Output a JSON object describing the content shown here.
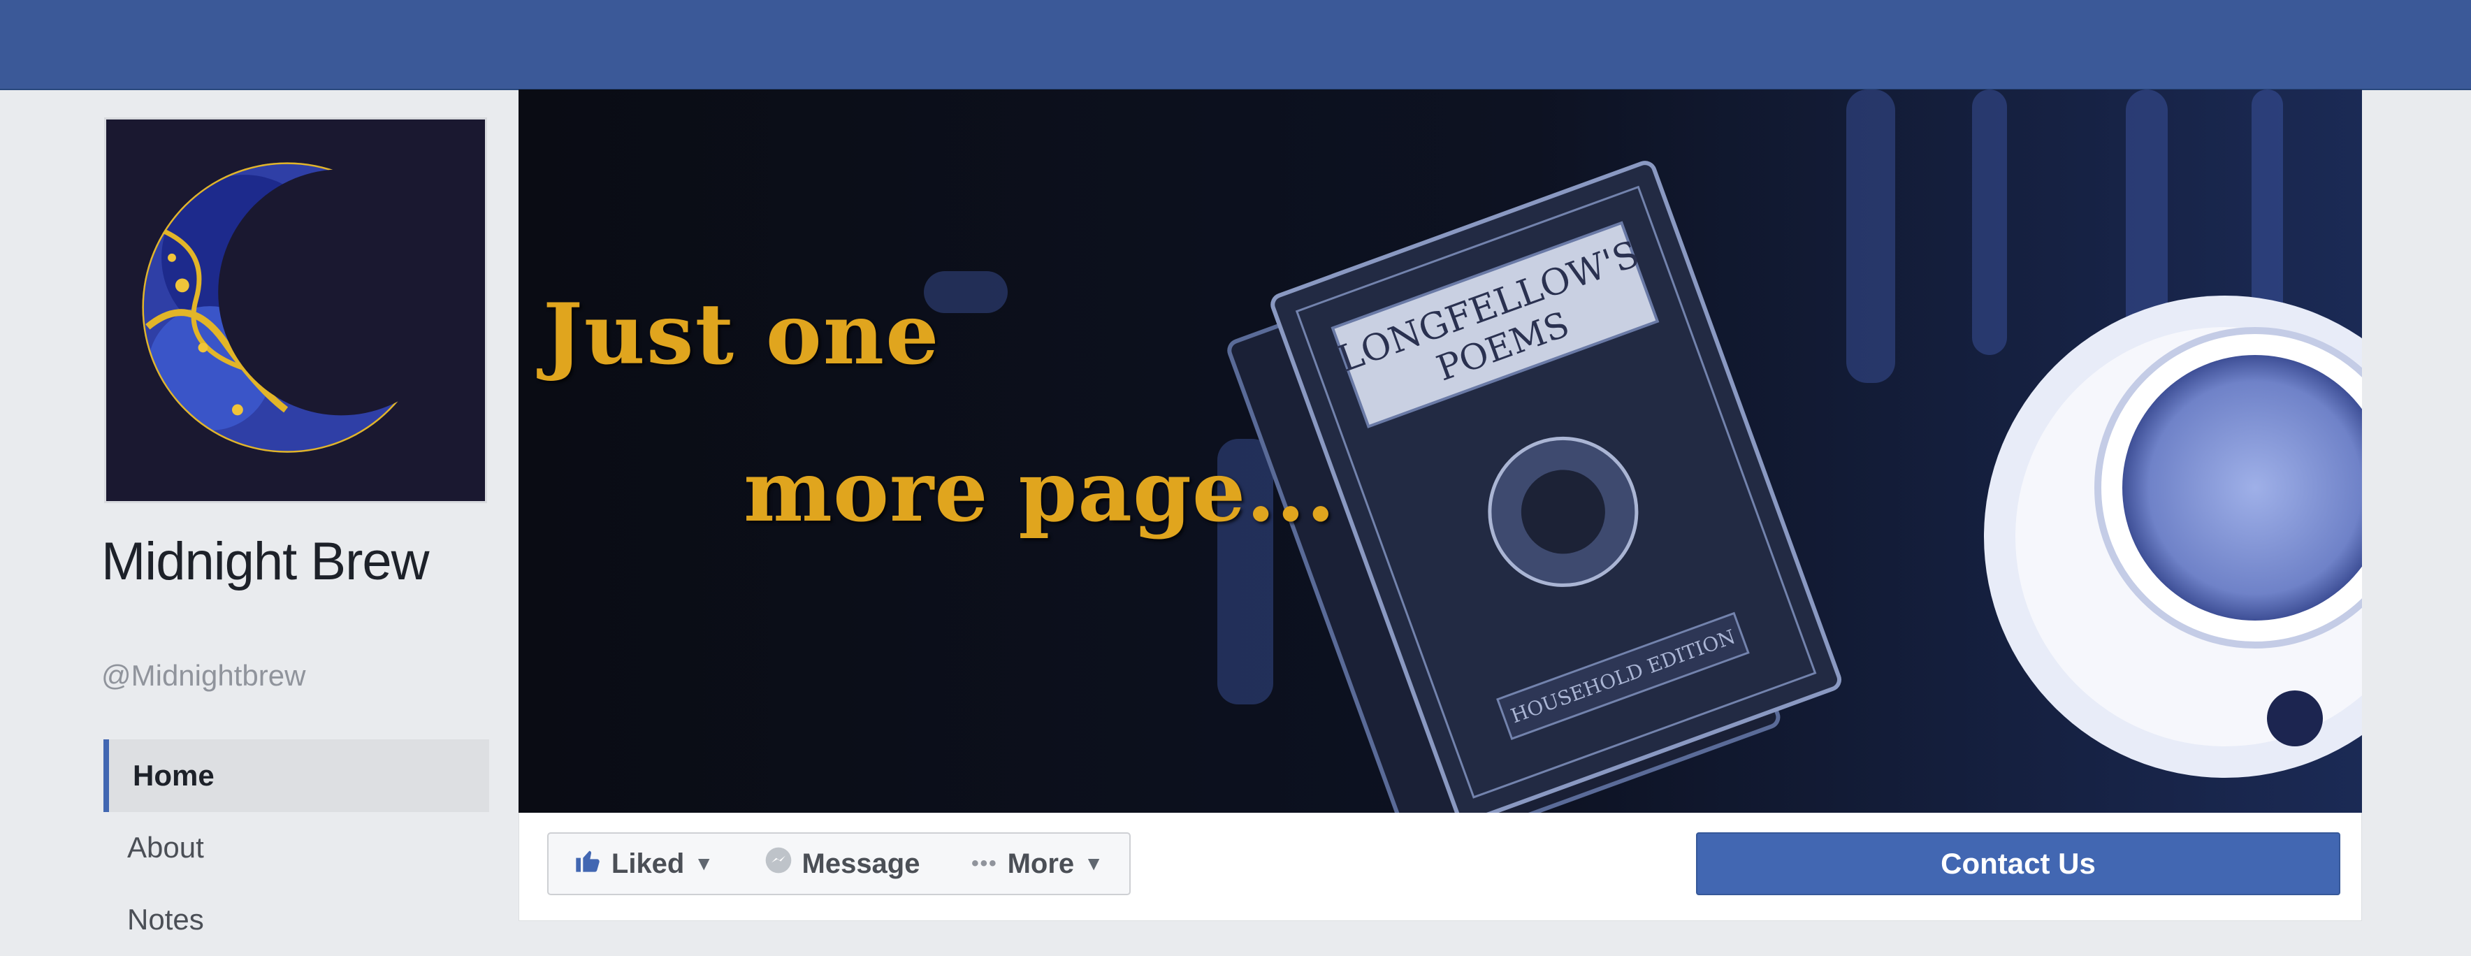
{
  "page": {
    "name": "Midnight Brew",
    "handle": "@Midnightbrew"
  },
  "nav": {
    "items": [
      {
        "label": "Home",
        "active": true
      },
      {
        "label": "About",
        "active": false
      },
      {
        "label": "Notes",
        "active": false
      }
    ]
  },
  "cover": {
    "line1": "Just one",
    "line2": "more page...",
    "book_title_line1": "LONGFELLOW'S",
    "book_title_line2": "POEMS",
    "book_edition": "HOUSEHOLD EDITION"
  },
  "actions": {
    "liked_label": "Liked",
    "message_label": "Message",
    "more_label": "More",
    "contact_label": "Contact Us"
  },
  "icons": {
    "liked": "thumbs-up-icon",
    "message": "messenger-icon",
    "more": "ellipsis-icon",
    "caret": "caret-down-icon"
  },
  "colors": {
    "topbar": "#3b5998",
    "accent": "#4267b2",
    "cover_text": "#e0a51e"
  }
}
